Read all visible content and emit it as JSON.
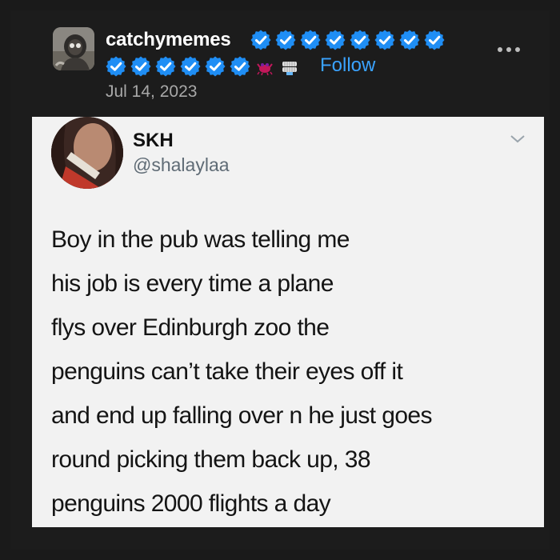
{
  "post": {
    "username": "catchymemes",
    "date": "Jul 14, 2023",
    "follow_label": "Follow",
    "badges_row1_count": 8,
    "badges_row2_count": 6,
    "badge_icon": "verified-check-icon",
    "extra_icons": [
      "crab-icon",
      "chattering-teeth-icon"
    ],
    "more_icon": "more-dots-icon"
  },
  "tweet": {
    "name": "SKH",
    "handle": "@shalaylaa",
    "chevron_icon": "chevron-down-icon",
    "lines": [
      "Boy in the pub was telling me",
      "his job is  every time a plane",
      "flys over Edinburgh zoo the",
      "penguins can’t take their eyes off it",
      "and end up falling over n he just goes",
      "round picking them back up, 38",
      "penguins 2000 flights a day"
    ]
  },
  "colors": {
    "background": "#1a1a1a",
    "text": "#ffffff",
    "muted": "#a8a8a8",
    "link": "#3aa3ff",
    "badge": "#1f8ef5",
    "card": "#f2f2f2"
  }
}
